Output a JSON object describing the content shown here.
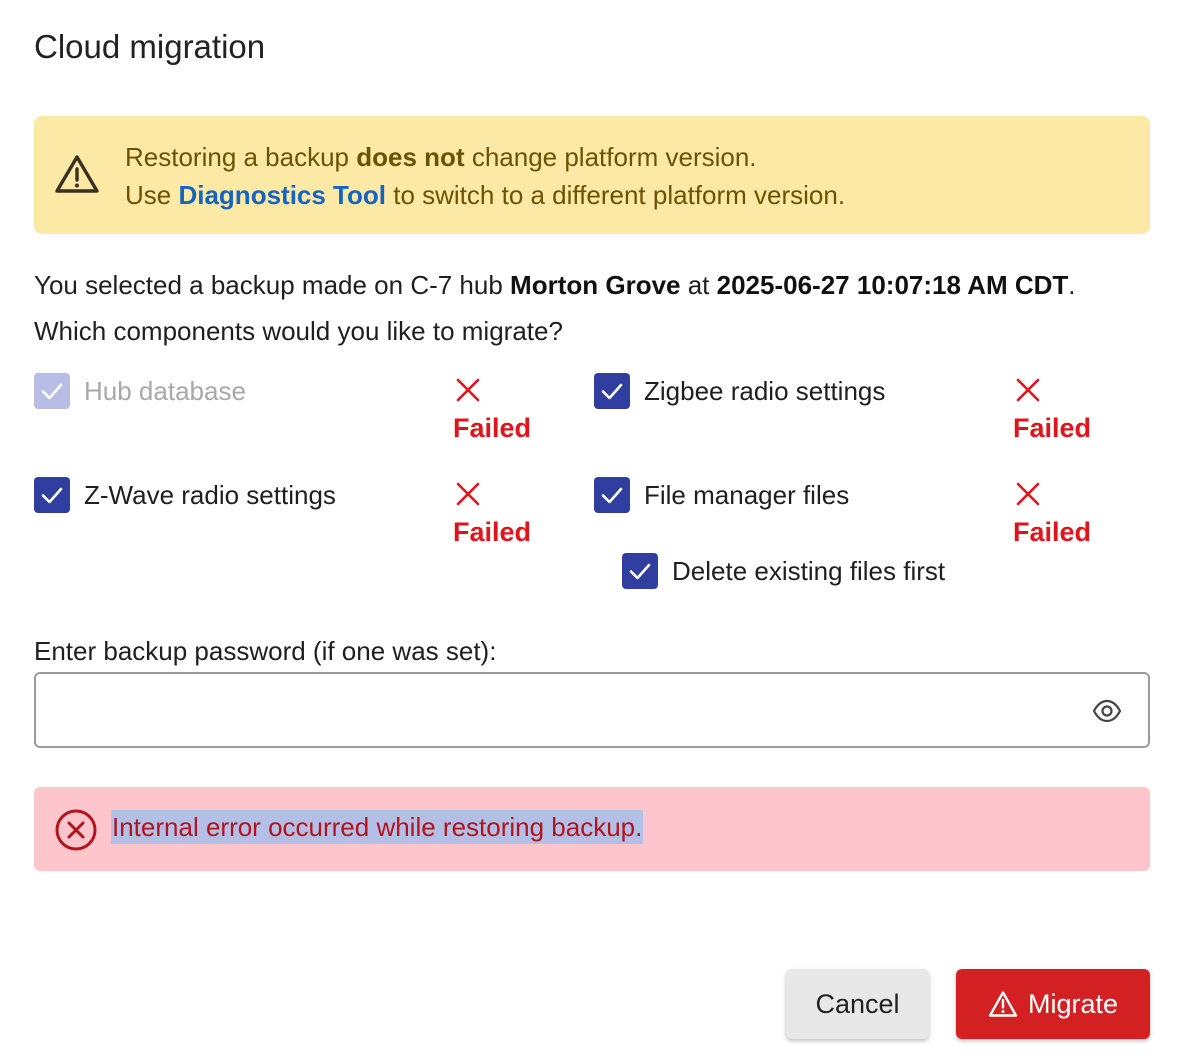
{
  "dialog": {
    "title": "Cloud migration"
  },
  "warning": {
    "line1_pre": "Restoring a backup ",
    "line1_bold": "does not",
    "line1_post": " change platform version.",
    "line2_pre": "Use ",
    "line2_link": "Diagnostics Tool",
    "line2_post": " to switch to a different platform version.",
    "color": "#fde9a6"
  },
  "intro": {
    "pre": "You selected a backup made on C-7 hub ",
    "hub_name": "Morton Grove",
    "mid": " at ",
    "timestamp": "2025-06-27 10:07:18 AM CDT",
    "post": ".",
    "question": "Which components would you like to migrate?"
  },
  "components": {
    "hub_database": {
      "label": "Hub database",
      "checked": true,
      "disabled": true,
      "status": "Failed"
    },
    "zigbee": {
      "label": "Zigbee radio settings",
      "checked": true,
      "disabled": false,
      "status": "Failed"
    },
    "zwave": {
      "label": "Z-Wave radio settings",
      "checked": true,
      "disabled": false,
      "status": "Failed"
    },
    "files": {
      "label": "File manager files",
      "checked": true,
      "disabled": false,
      "status": "Failed"
    },
    "delete_files": {
      "label": "Delete existing files first",
      "checked": true,
      "disabled": false
    }
  },
  "password": {
    "label": "Enter backup password (if one was set):",
    "value": "",
    "placeholder": "",
    "icon": "eye-icon"
  },
  "error": {
    "message": "Internal error occurred while restoring backup.",
    "icon": "error-circle-icon",
    "color": "#fec6cc"
  },
  "buttons": {
    "cancel_label": "Cancel",
    "migrate_label": "Migrate",
    "migrate_color": "#d32023"
  }
}
